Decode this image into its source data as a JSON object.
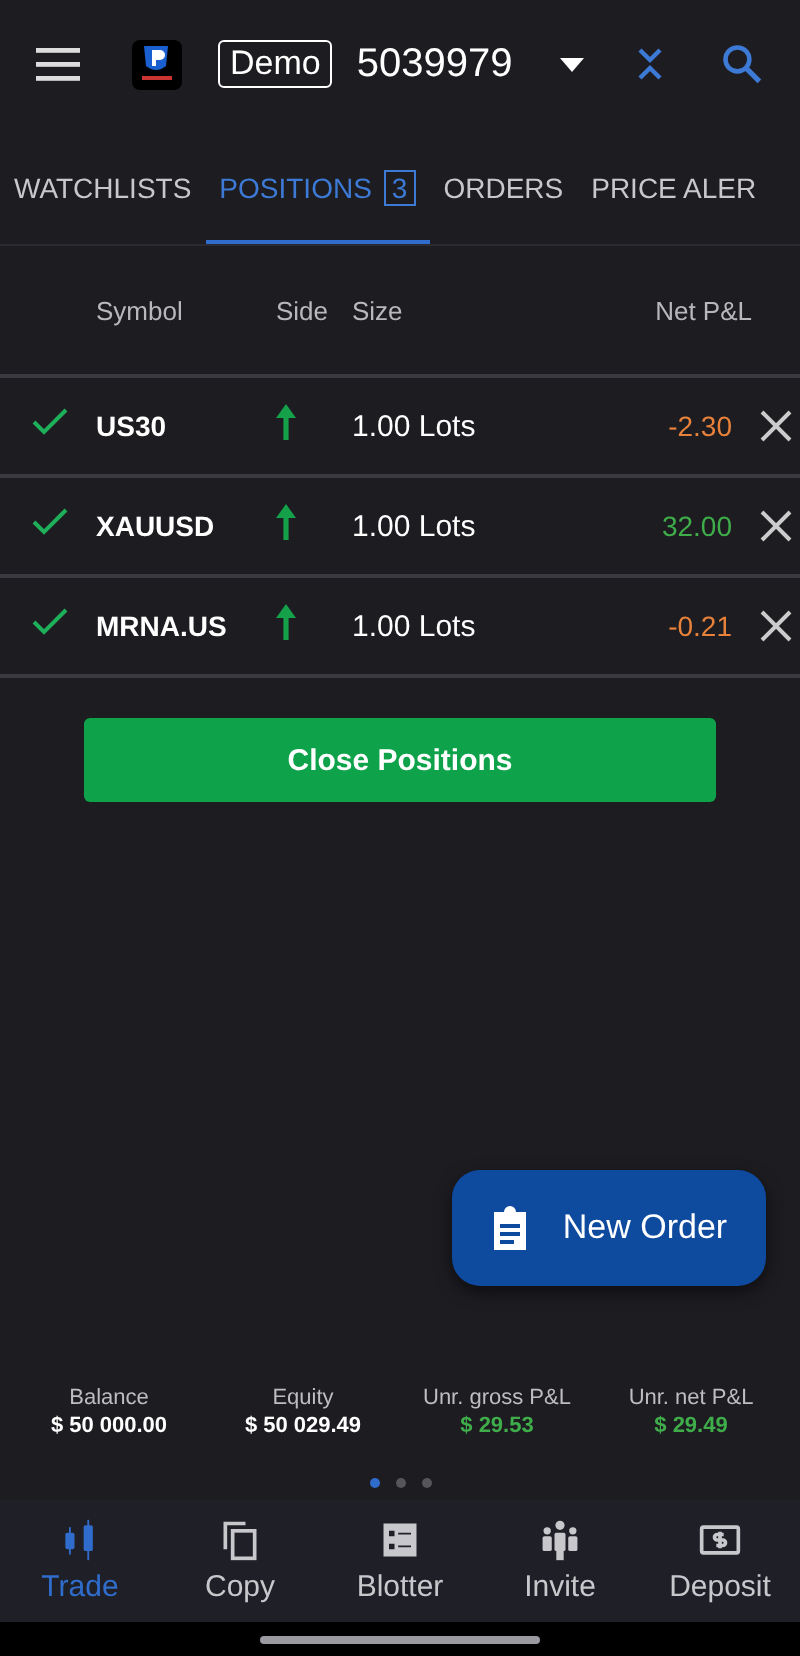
{
  "header": {
    "account_badge": "Demo",
    "account_number": "5039979"
  },
  "tabs": [
    {
      "label": "WATCHLISTS",
      "selected": false
    },
    {
      "label": "POSITIONS",
      "count": "3",
      "selected": true
    },
    {
      "label": "ORDERS",
      "selected": false
    },
    {
      "label": "PRICE ALER",
      "selected": false
    }
  ],
  "table": {
    "columns": [
      "Symbol",
      "Side",
      "Size",
      "Net P&L"
    ],
    "rows": [
      {
        "confirmed": true,
        "symbol": "US30",
        "kind": "buy",
        "size": "1.00 Lots",
        "pnl": "-2.30",
        "color": "#e8823a"
      },
      {
        "confirmed": true,
        "symbol": "XAUUSD",
        "kind": "buy",
        "size": "1.00 Lots",
        "pnl": "32.00",
        "color": "#3fae4a"
      },
      {
        "confirmed": true,
        "symbol": "MRNA.US",
        "kind": "buy",
        "size": "1.00 Lots",
        "pnl": "-0.21",
        "color": "#e8823a"
      }
    ]
  },
  "close_button": "Close Positions",
  "new_order_button": "New Order",
  "stats": [
    {
      "label": "Balance",
      "value": "$ 50 000.00",
      "color": "#ffffff"
    },
    {
      "label": "Equity",
      "value": "$ 50 029.49",
      "color": "#ffffff"
    },
    {
      "label": "Unr. gross P&L",
      "value": "$ 29.53",
      "color": "#3fae4a"
    },
    {
      "label": "Unr. net P&L",
      "value": "$ 29.49",
      "color": "#3fae4a"
    }
  ],
  "pager": [
    {
      "selected": true
    },
    {
      "selected": false
    },
    {
      "selected": false
    }
  ],
  "nav": [
    {
      "label": "Trade",
      "kind": "trade",
      "selected": true
    },
    {
      "label": "Copy",
      "kind": "copy",
      "selected": false
    },
    {
      "label": "Blotter",
      "kind": "blotter",
      "selected": false
    },
    {
      "label": "Invite",
      "kind": "invite",
      "selected": false
    },
    {
      "label": "Deposit",
      "kind": "deposit",
      "selected": false
    }
  ]
}
